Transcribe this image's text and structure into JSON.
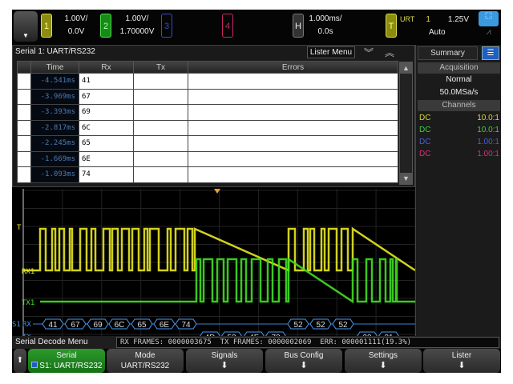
{
  "topbar": {
    "ch1": {
      "num": "1",
      "scale": "1.00V/",
      "offset": "0.0V",
      "color": "#c8c832"
    },
    "ch2": {
      "num": "2",
      "scale": "1.00V/",
      "offset": "1.70000V",
      "color": "#2fbf2f"
    },
    "ch3": {
      "num": "3",
      "color": "#3a4cc8"
    },
    "ch4": {
      "num": "4",
      "color": "#c8286a"
    },
    "horizontal": {
      "label": "H",
      "scale": "1.000ms/",
      "delay": "0.0s"
    },
    "trigger": {
      "label": "T",
      "type": "URT",
      "source": "1",
      "level": "1.25V",
      "mode": "Auto"
    }
  },
  "lister": {
    "title": "Serial 1: UART/RS232",
    "menu_label": "Lister Menu",
    "columns": [
      "Time",
      "Rx",
      "Tx",
      "Errors"
    ],
    "rows": [
      {
        "time": "-4.541ms",
        "rx": "41",
        "tx": "",
        "errors": ""
      },
      {
        "time": "-3.969ms",
        "rx": "67",
        "tx": "",
        "errors": ""
      },
      {
        "time": "-3.393ms",
        "rx": "69",
        "tx": "",
        "errors": ""
      },
      {
        "time": "-2.817ms",
        "rx": "6C",
        "tx": "",
        "errors": ""
      },
      {
        "time": "-2.245ms",
        "rx": "65",
        "tx": "",
        "errors": ""
      },
      {
        "time": "-1.669ms",
        "rx": "6E",
        "tx": "",
        "errors": ""
      },
      {
        "time": "-1.093ms",
        "rx": "74",
        "tx": "",
        "errors": ""
      }
    ]
  },
  "side": {
    "summary_tab": "Summary",
    "acquisition_header": "Acquisition",
    "acq_mode": "Normal",
    "sample_rate": "50.0MSa/s",
    "channels_header": "Channels",
    "channels": [
      {
        "coupling": "DC",
        "probe": "10.0:1",
        "color": "#d8d832"
      },
      {
        "coupling": "DC",
        "probe": "10.0:1",
        "color": "#3fd23f"
      },
      {
        "coupling": "DC",
        "probe": "1.00:1",
        "color": "#4a5ed8"
      },
      {
        "coupling": "DC",
        "probe": "1.00:1",
        "color": "#d8307a"
      }
    ]
  },
  "waveform": {
    "trigger_marker": "T",
    "ch1_label": "RX1",
    "ch2_label": "TX1",
    "bus_label": "S1",
    "rx_label": "RX",
    "tx_label": "TX",
    "rx_decode": [
      "41",
      "67",
      "69",
      "6C",
      "65",
      "6E",
      "74",
      "52",
      "52",
      "52"
    ],
    "tx_decode": [
      "4D",
      "53",
      "4F",
      "73",
      "23",
      "31"
    ]
  },
  "status": {
    "menu_title": "Serial Decode Menu",
    "bar": "RX FRAMES: 0000003675  TX FRAMES: 0000002069  ERR: 000001111(19.3%)"
  },
  "softkeys": [
    {
      "label": "Serial",
      "value": "S1: UART/RS232"
    },
    {
      "label": "Mode",
      "value": "UART/RS232"
    },
    {
      "label": "Signals",
      "value": ""
    },
    {
      "label": "Bus Config",
      "value": ""
    },
    {
      "label": "Settings",
      "value": ""
    },
    {
      "label": "Lister",
      "value": ""
    }
  ]
}
